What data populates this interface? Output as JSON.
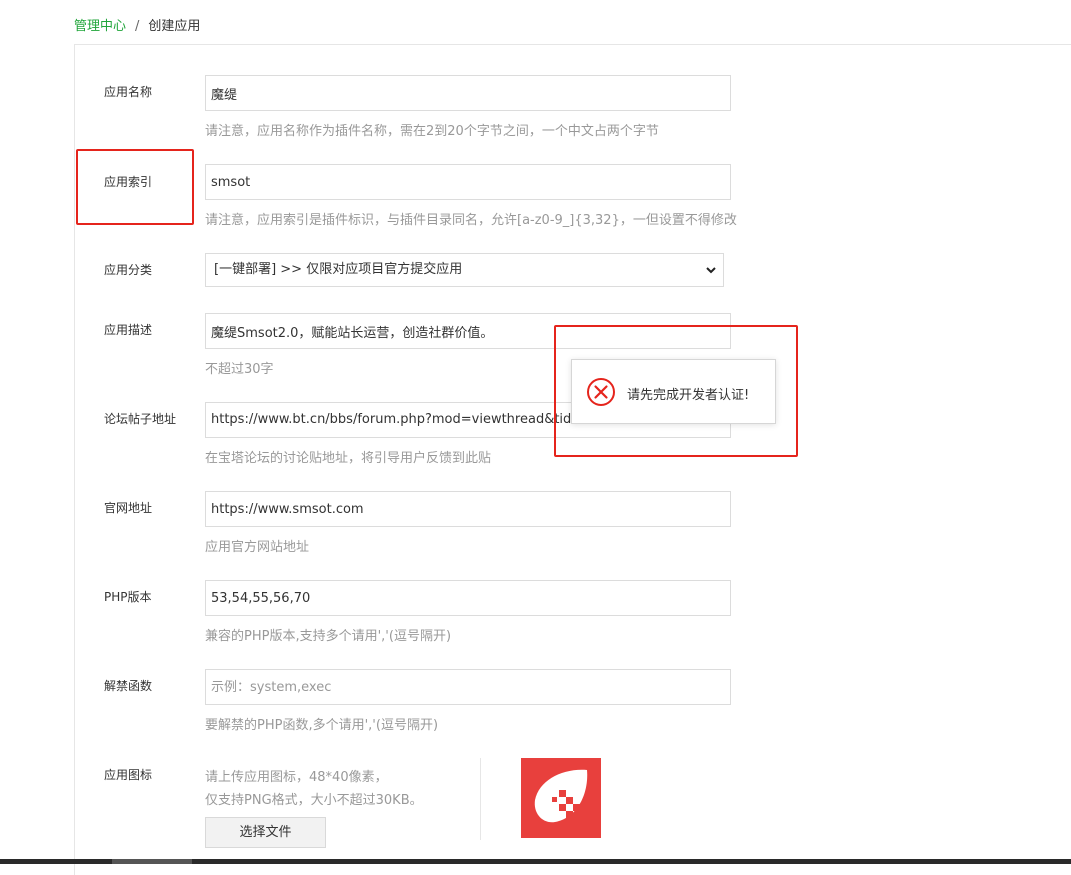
{
  "breadcrumb": {
    "home": "管理中心",
    "separator": "/",
    "current": "创建应用"
  },
  "form": {
    "app_name": {
      "label": "应用名称",
      "value": "魔缇",
      "hint": "请注意，应用名称作为插件名称，需在2到20个字节之间，一个中文占两个字节"
    },
    "app_index": {
      "label": "应用索引",
      "value": "smsot",
      "hint": "请注意，应用索引是插件标识，与插件目录同名，允许[a-z0-9_]{3,32}，一但设置不得修改"
    },
    "app_category": {
      "label": "应用分类",
      "selected": "[一键部署] >> 仅限对应项目官方提交应用"
    },
    "app_desc": {
      "label": "应用描述",
      "value": "魔缇Smsot2.0，赋能站长运营，创造社群价值。",
      "hint": "不超过30字"
    },
    "forum_url": {
      "label": "论坛帖子地址",
      "value": "https://www.bt.cn/bbs/forum.php?mod=viewthread&tid=64289",
      "hint": "在宝塔论坛的讨论贴地址，将引导用户反馈到此贴"
    },
    "website": {
      "label": "官网地址",
      "value": "https://www.smsot.com",
      "hint": "应用官方网站地址"
    },
    "php_version": {
      "label": "PHP版本",
      "value": "53,54,55,56,70",
      "hint": "兼容的PHP版本,支持多个请用','(逗号隔开)"
    },
    "unban_funcs": {
      "label": "解禁函数",
      "placeholder": "示例：system,exec",
      "value": "",
      "hint": "要解禁的PHP函数,多个请用','(逗号隔开)"
    },
    "app_icon": {
      "label": "应用图标",
      "hint_line1": "请上传应用图标，48*40像素，",
      "hint_line2": "仅支持PNG格式，大小不超过30KB。",
      "upload_label": "选择文件"
    }
  },
  "toast": {
    "message": "请先完成开发者认证!",
    "icon": "error-circle-icon"
  },
  "colors": {
    "accent": "#20a53a",
    "highlight": "#e5241c",
    "icon_bg": "#e8403d"
  }
}
